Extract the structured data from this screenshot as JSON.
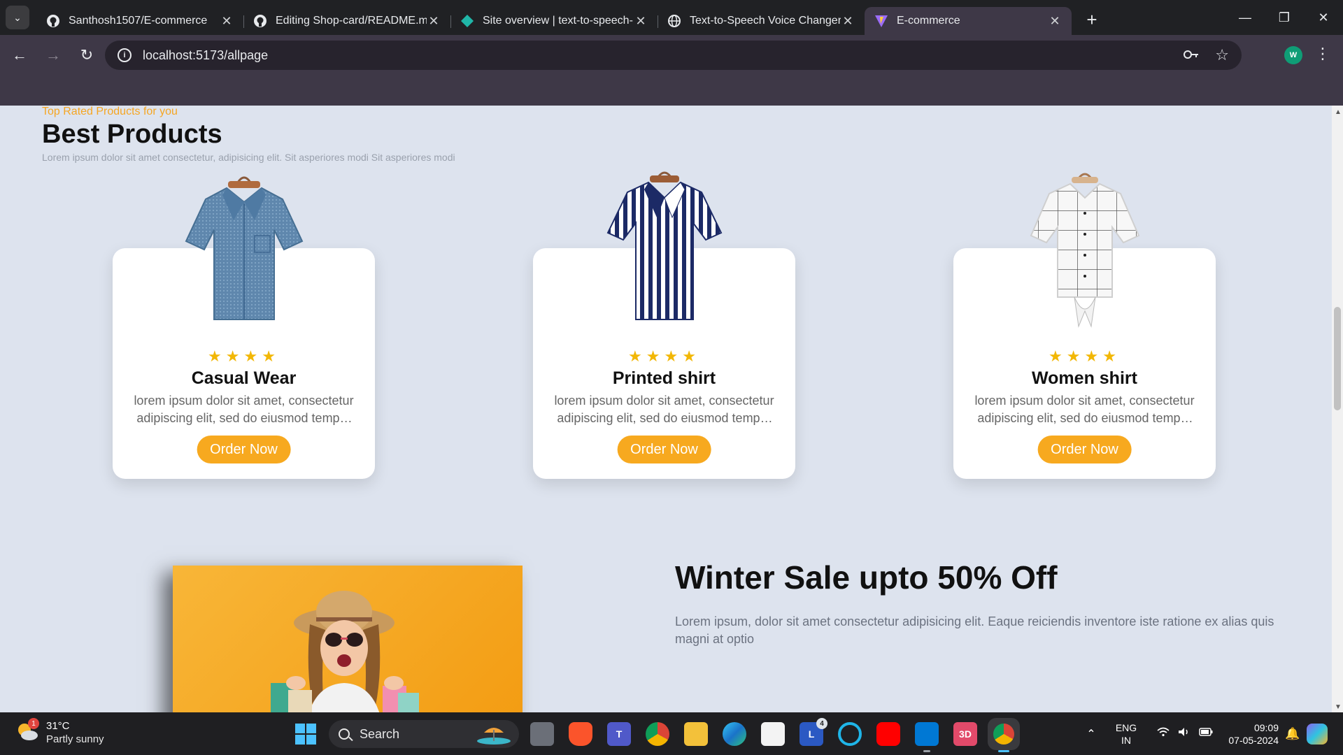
{
  "browser": {
    "tabs": [
      {
        "title": "Santhosh1507/E-commerce",
        "icon": "github-icon",
        "active": false
      },
      {
        "title": "Editing Shop-card/README.md",
        "icon": "github-icon",
        "active": false
      },
      {
        "title": "Site overview | text-to-speech-",
        "icon": "netlify-icon",
        "active": false
      },
      {
        "title": "Text-to-Speech Voice Changer",
        "icon": "globe-icon",
        "active": false
      },
      {
        "title": "E-commerce",
        "icon": "vite-icon",
        "active": true
      }
    ],
    "close_glyph": "✕",
    "new_tab_glyph": "+",
    "url": "localhost:5173/allpage",
    "profile_initial": "W"
  },
  "page": {
    "eyebrow": "Top Rated Products for you",
    "heading": "Best Products",
    "subtext": "Lorem ipsum dolor sit amet consectetur, adipisicing elit. Sit asperiores modi Sit asperiores modi",
    "products": [
      {
        "title": "Casual Wear",
        "stars": "★★★★",
        "rating": 4,
        "desc": "lorem ipsum dolor sit amet, consectetur adipiscing elit, sed do eiusmod tempor incididunt ut labore",
        "button": "Order Now",
        "shirt": "blue-checked-shirt"
      },
      {
        "title": "Printed shirt",
        "stars": "★★★★",
        "rating": 4,
        "desc": "lorem ipsum dolor sit amet, consectetur adipiscing elit, sed do eiusmod tempor incididunt ut labore",
        "button": "Order Now",
        "shirt": "navy-striped-shirt"
      },
      {
        "title": "Women shirt",
        "stars": "★★★★",
        "rating": 4,
        "desc": "lorem ipsum dolor sit amet, consectetur adipiscing elit, sed do eiusmod tempor incididunt ut labore",
        "button": "Order Now",
        "shirt": "white-grid-tie-shirt"
      }
    ],
    "sale": {
      "title": "Winter Sale upto 50% Off",
      "desc": "Lorem ipsum, dolor sit amet consectetur adipisicing elit. Eaque reiciendis inventore iste ratione ex alias quis magni at optio"
    },
    "colors": {
      "accent": "#f7a91f",
      "star": "#f2b705",
      "background": "#dde3ee"
    }
  },
  "taskbar": {
    "weather_temp": "31°C",
    "weather_cond": "Partly sunny",
    "weather_badge": "1",
    "search_label": "Search",
    "teams_label": "T",
    "l_label": "L",
    "l_badge": "4",
    "threed_label": "3D",
    "lang_1": "ENG",
    "lang_2": "IN",
    "time": "09:09",
    "date": "07-05-2024"
  }
}
